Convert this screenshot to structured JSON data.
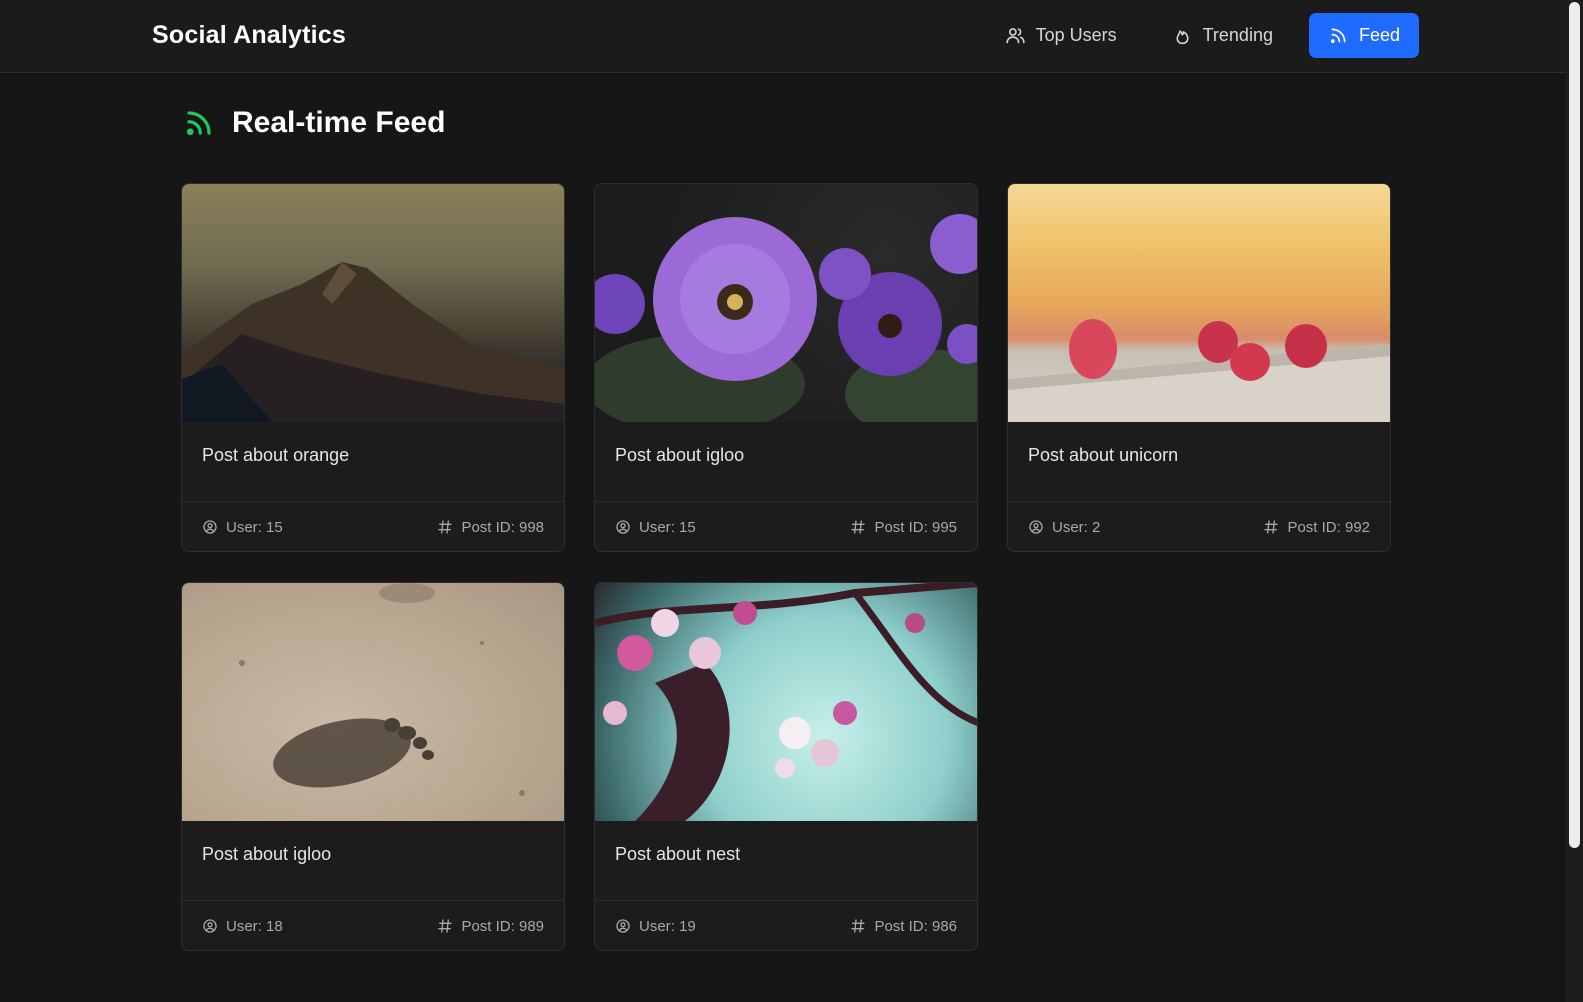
{
  "header": {
    "brand": "Social Analytics",
    "nav": [
      {
        "label": "Top Users",
        "icon": "users-icon",
        "active": false
      },
      {
        "label": "Trending",
        "icon": "flame-icon",
        "active": false
      },
      {
        "label": "Feed",
        "icon": "rss-icon",
        "active": true
      }
    ]
  },
  "page": {
    "title": "Real-time Feed",
    "title_icon": "rss-icon"
  },
  "posts": [
    {
      "title": "Post about orange",
      "user": "User: 15",
      "post_id": "Post ID: 998",
      "image": "mountain-photo"
    },
    {
      "title": "Post about igloo",
      "user": "User: 15",
      "post_id": "Post ID: 995",
      "image": "purple-flowers-photo"
    },
    {
      "title": "Post about unicorn",
      "user": "User: 2",
      "post_id": "Post ID: 992",
      "image": "raspberries-photo"
    },
    {
      "title": "Post about igloo",
      "user": "User: 18",
      "post_id": "Post ID: 989",
      "image": "footprint-sand-photo"
    },
    {
      "title": "Post about nest",
      "user": "User: 19",
      "post_id": "Post ID: 986",
      "image": "blossom-branch-photo"
    }
  ],
  "colors": {
    "background": "#161616",
    "header": "#1b1b1b",
    "accent": "#1f6bff",
    "feed_icon": "#22c55e"
  }
}
